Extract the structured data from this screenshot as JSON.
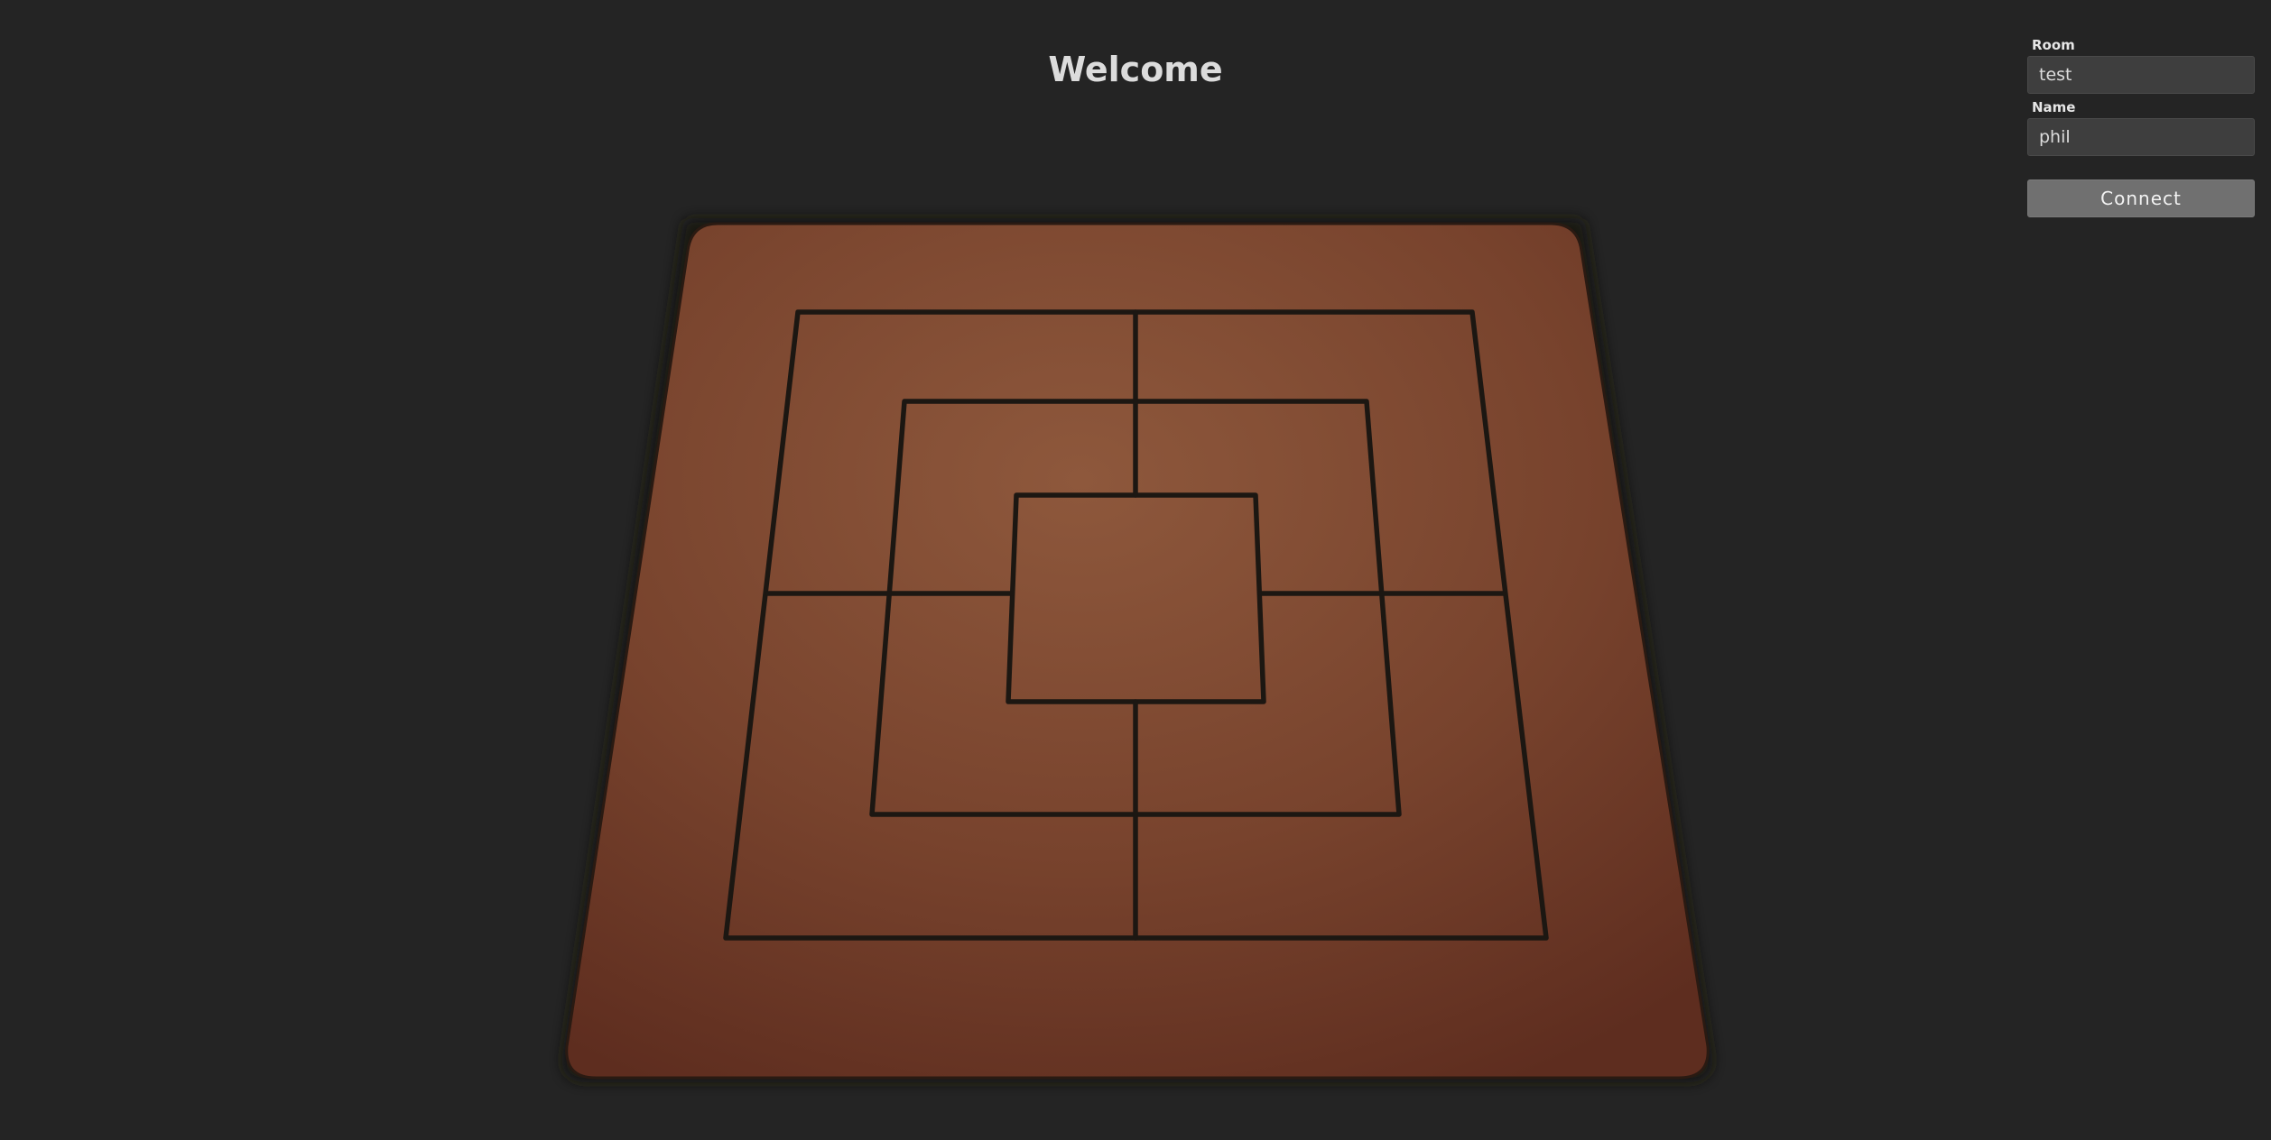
{
  "header": {
    "title": "Welcome"
  },
  "connect_form": {
    "room_label": "Room",
    "room_value": "test",
    "name_label": "Name",
    "name_value": "phil",
    "connect_label": "Connect"
  },
  "board": {
    "game": "nine men's morris",
    "board_color": "#7a4630",
    "line_color": "#1c1712",
    "pieces": []
  },
  "colors": {
    "background": "#242424",
    "button": "#707070",
    "input": "#3e3e3e"
  }
}
